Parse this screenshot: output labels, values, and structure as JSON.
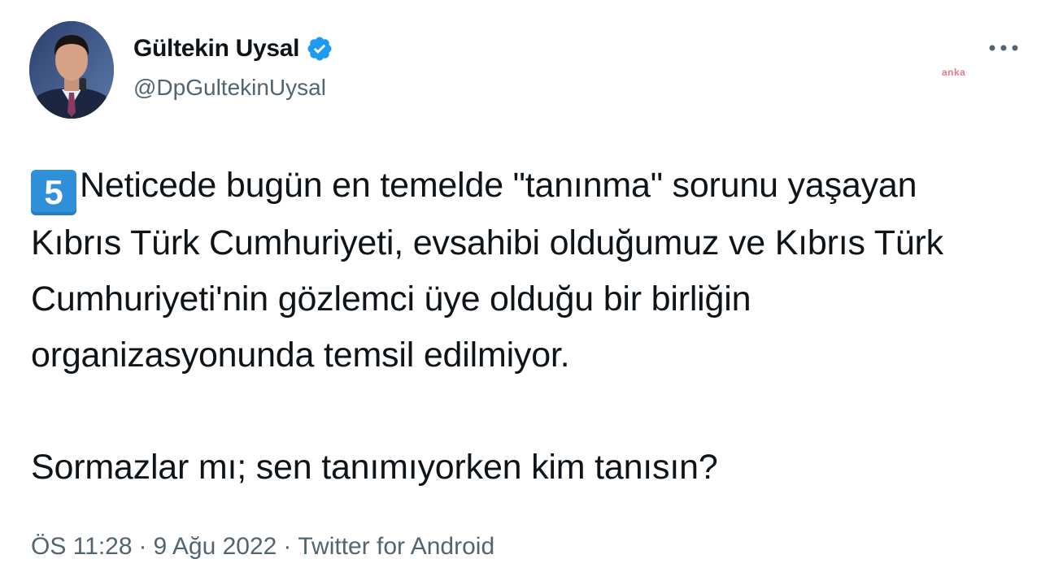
{
  "author": {
    "display_name": "Gültekin Uysal",
    "handle": "@DpGultekinUysal",
    "verified_icon": "verified-badge-icon",
    "avatar_icon": "profile-photo"
  },
  "more_icon": "more-options-icon",
  "watermark": "anka",
  "tweet": {
    "number_emoji": "5",
    "paragraph1": "Neticede bugün en temelde \"tanınma\" sorunu yaşayan Kıbrıs Türk Cumhuriyeti, evsahibi olduğumuz ve Kıbrıs Türk Cumhuriyeti'nin gözlemci üye olduğu bir birliğin organizasyonunda temsil edilmiyor.",
    "paragraph2": "Sormazlar mı; sen tanımıyorken kim tanısın?"
  },
  "meta": {
    "time": "ÖS 11:28",
    "separator1": "·",
    "date": "9 Ağu 2022",
    "separator2": "·",
    "source": "Twitter for Android"
  },
  "colors": {
    "verified": "#1d9bf0",
    "keycap": "#2f8fd8",
    "secondary_text": "#536471",
    "primary_text": "#0f1419"
  }
}
